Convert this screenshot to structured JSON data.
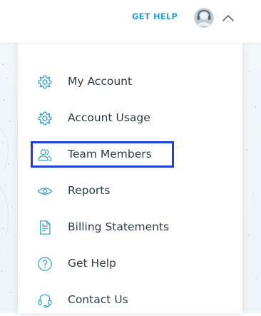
{
  "header": {
    "get_help_label": "GET HELP",
    "colors": {
      "link": "#2a9fd0",
      "icon": "#3aa3c9",
      "highlight": "#1f3fd6"
    }
  },
  "menu": {
    "items": [
      {
        "label": "My Account",
        "icon": "gear-icon"
      },
      {
        "label": "Account Usage",
        "icon": "gear-icon"
      },
      {
        "label": "Team Members",
        "icon": "team-members-icon",
        "highlighted": true
      },
      {
        "label": "Reports",
        "icon": "eye-icon"
      },
      {
        "label": "Billing Statements",
        "icon": "document-icon"
      },
      {
        "label": "Get Help",
        "icon": "question-circle-icon"
      },
      {
        "label": "Contact Us",
        "icon": "headset-icon"
      }
    ]
  }
}
